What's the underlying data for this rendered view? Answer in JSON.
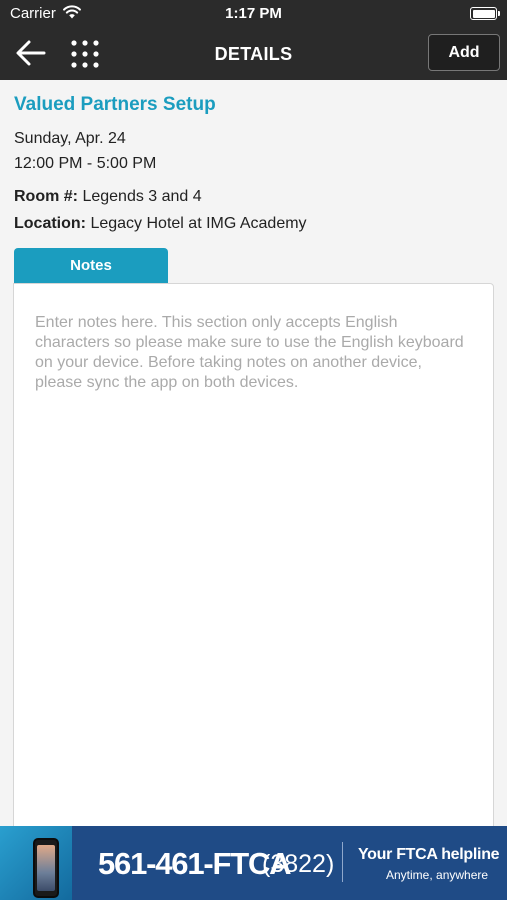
{
  "status_bar": {
    "carrier": "Carrier",
    "time": "1:17 PM",
    "icons": [
      "wifi-icon",
      "battery-icon"
    ]
  },
  "nav": {
    "title": "DETAILS",
    "add_label": "Add",
    "icons": [
      "back-arrow-icon",
      "grid-menu-icon"
    ]
  },
  "event": {
    "title": "Valued Partners Setup",
    "date": "Sunday, Apr. 24",
    "time_range": "12:00 PM - 5:00 PM",
    "room_label": "Room #:",
    "room_value": "Legends 3 and 4",
    "location_label": "Location:",
    "location_value": "Legacy Hotel at IMG Academy"
  },
  "notes": {
    "tab_label": "Notes",
    "placeholder": "Enter notes here. This section only accepts English characters so please make sure to use the English keyboard on your device. Before taking notes on another device, please sync the app on both devices."
  },
  "banner": {
    "phone_number": "561-461-FTCA",
    "phone_extension": "(3822)",
    "helpline": "Your FTCA helpline",
    "tagline": "Anytime, anywhere"
  },
  "colors": {
    "accent": "#1b9dbf",
    "nav_background": "#2b2b2b",
    "banner_background": "#1f4b86"
  }
}
